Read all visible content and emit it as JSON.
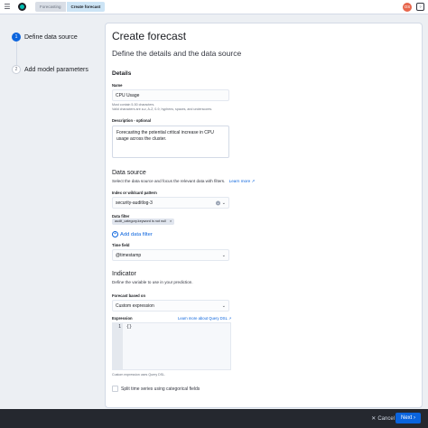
{
  "header": {
    "menu_icon": "hamburger-icon",
    "breadcrumbs": [
      "Forecasting",
      "Create forecast"
    ],
    "avatar_initials": "OS"
  },
  "steps": [
    {
      "number": "1",
      "label": "Define data source",
      "state": "active"
    },
    {
      "number": "2",
      "label": "Add model parameters",
      "state": "todo"
    }
  ],
  "page": {
    "title": "Create forecast",
    "subtitle": "Define the details and the data source"
  },
  "details": {
    "heading": "Details",
    "name_label": "Name",
    "name_value": "CPU Usage",
    "name_help1": "Must contain 5-50 characters.",
    "name_help2": "Valid characters are a-z, A-Z, 0-9, hyphens, spaces, and underscores.",
    "desc_label": "Description - optional",
    "desc_value": "Forecasting the potential critical increase in CPU usage across the cluster."
  },
  "data_source": {
    "heading": "Data source",
    "description": "Select the data source and focus the relevant data with filters.",
    "learn_more": "Learn more",
    "index_label": "Index or wildcard pattern",
    "index_value": "security-auditlog-3",
    "filter_label": "Data filter",
    "filter_pill": "audit_category.keyword is not null",
    "add_filter": "Add data filter",
    "timefield_label": "Time field",
    "timefield_value": "@timestamp"
  },
  "indicator": {
    "heading": "Indicator",
    "description": "Define the variable to use in your prediction.",
    "based_on_label": "Forecast based on",
    "based_on_value": "Custom expression",
    "expression_label": "Expression",
    "expression_link": "Learn more about Query DSL",
    "line_number": "1",
    "code": "{}",
    "help": "Custom expression uses Query DSL."
  },
  "categorical_label": "Split time series using categorical fields",
  "footer": {
    "cancel": "Cancel",
    "next": "Next"
  },
  "colors": {
    "primary": "#0b64dd",
    "avatar": "#e7664c",
    "footer": "#25282f"
  }
}
